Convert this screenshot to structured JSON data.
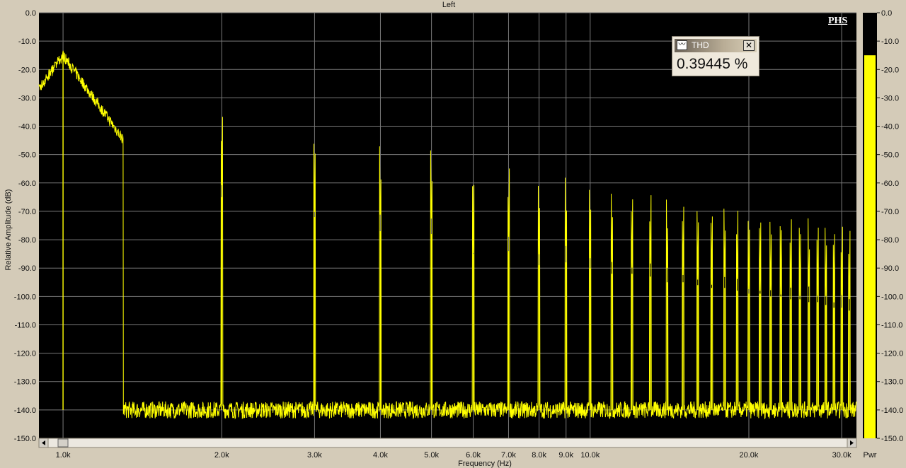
{
  "panel": {
    "title": "Left"
  },
  "logo_text": "PHS",
  "thd_box": {
    "title": "THD",
    "value": "0.39445 %",
    "close_icon": "close-icon",
    "wave_icon": "waveform-icon"
  },
  "meter": {
    "label": "Pwr",
    "level_db": -15,
    "fill_color": "#ffff00",
    "ticks": [
      "0.0",
      "-10.0",
      "-20.0",
      "-30.0",
      "-40.0",
      "-50.0",
      "-60.0",
      "-70.0",
      "-80.0",
      "-90.0",
      "-100.0",
      "-110.0",
      "-120.0",
      "-130.0",
      "-140.0",
      "-150.0"
    ]
  },
  "colors": {
    "background": "#000000",
    "trace": "#ffff00",
    "grid": "#7a7a7a",
    "frame": "#d4cbb8"
  },
  "chart_data": {
    "type": "line",
    "title": "Left",
    "xlabel": "Frequency (Hz)",
    "ylabel": "Relative Amplitude (dB)",
    "xscale": "log",
    "xlim": [
      900,
      32000
    ],
    "ylim": [
      -150,
      0
    ],
    "grid": true,
    "x_ticks": [
      1000,
      2000,
      3000,
      4000,
      5000,
      6000,
      7000,
      8000,
      9000,
      10000,
      20000,
      30000
    ],
    "x_tick_labels": [
      "1.0k",
      "2.0k",
      "3.0k",
      "4.0k",
      "5.0k",
      "6.0k",
      "7.0k",
      "8.0k",
      "9.0k",
      "10.0k",
      "20.0k",
      "30.0k"
    ],
    "y_ticks": [
      0,
      -10,
      -20,
      -30,
      -40,
      -50,
      -60,
      -70,
      -80,
      -90,
      -100,
      -110,
      -120,
      -130,
      -140,
      -150
    ],
    "y_tick_labels": [
      "0.0",
      "-10.0",
      "-20.0",
      "-30.0",
      "-40.0",
      "-50.0",
      "-60.0",
      "-70.0",
      "-80.0",
      "-90.0",
      "-100.0",
      "-110.0",
      "-120.0",
      "-130.0",
      "-140.0",
      "-150.0"
    ],
    "noise_floor_db": -140,
    "peaks": [
      {
        "freq": 1000,
        "db": -15
      },
      {
        "freq": 2000,
        "db": -65
      },
      {
        "freq": 3000,
        "db": -72
      },
      {
        "freq": 4000,
        "db": -77
      },
      {
        "freq": 5000,
        "db": -78
      },
      {
        "freq": 6000,
        "db": -85
      },
      {
        "freq": 7000,
        "db": -84
      },
      {
        "freq": 8000,
        "db": -89
      },
      {
        "freq": 9000,
        "db": -88
      },
      {
        "freq": 10000,
        "db": -90
      },
      {
        "freq": 11000,
        "db": -92
      },
      {
        "freq": 12000,
        "db": -92
      },
      {
        "freq": 13000,
        "db": -93
      },
      {
        "freq": 14000,
        "db": -95
      },
      {
        "freq": 15000,
        "db": -95
      },
      {
        "freq": 16000,
        "db": -96
      },
      {
        "freq": 17000,
        "db": -97
      },
      {
        "freq": 18000,
        "db": -97
      },
      {
        "freq": 19000,
        "db": -98
      },
      {
        "freq": 20000,
        "db": -99
      },
      {
        "freq": 21000,
        "db": -99
      },
      {
        "freq": 22000,
        "db": -100
      },
      {
        "freq": 23000,
        "db": -100
      },
      {
        "freq": 24000,
        "db": -101
      },
      {
        "freq": 25000,
        "db": -101
      },
      {
        "freq": 26000,
        "db": -102
      },
      {
        "freq": 27000,
        "db": -102
      },
      {
        "freq": 28000,
        "db": -103
      },
      {
        "freq": 29000,
        "db": -104
      },
      {
        "freq": 30000,
        "db": -104
      },
      {
        "freq": 31000,
        "db": -105
      }
    ]
  }
}
